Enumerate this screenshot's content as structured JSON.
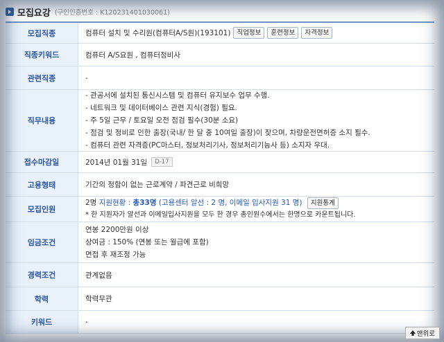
{
  "header": {
    "title": "모집요강",
    "subtitle": "(구인인증번호 : K120231401030061)"
  },
  "rows": {
    "job_category": {
      "label": "모집직종",
      "value": "컴퓨터 설치 및 수리원(컴퓨터A/S원)(193101)",
      "buttons": [
        "직업정보",
        "훈련정보",
        "자격정보"
      ]
    },
    "job_keyword": {
      "label": "직종키워드",
      "value": "컴퓨터 A/S요원 , 컴퓨터정비사"
    },
    "related_job": {
      "label": "관련직종",
      "value": "-"
    },
    "job_description": {
      "label": "직무내용",
      "lines": [
        "- 관공서에 설치된 통신시스템 및 컴퓨터 유지보수 업무 수행.",
        "- 네트워크 및 데이터베이스 관련 지식(경험) 필요.",
        "- 주 5일 근무 / 토요일 오전 점검 필수(30분 소요)",
        "- 점검 및 정비로 인한 출장(국내/ 한 달 중 10여일 출장)이 잦으며, 차량운전면허증 소지 필수.",
        "- 컴퓨터 관련 자격증(PC마스터, 정보처리기사, 정보처리기능사 등) 소지자 우대."
      ]
    },
    "deadline": {
      "label": "접수마감일",
      "value": "2014년 01월 31일",
      "dday": "D-17"
    },
    "employment_type": {
      "label": "고용형태",
      "value": "기간의 정함이 없는 근로계약 / 파견근로 비희망"
    },
    "recruit_count": {
      "label": "모집인원",
      "count": "2명",
      "status_prefix": "지원현황 : ",
      "status_total": "총33명",
      "status_detail": " (고용센터 알선 : 2 명, 이메일 입사지원 31 명)",
      "stats_button": "지원통계",
      "note": "* 한 지원자가 알선과 이메일입사지원을 모두 한 경우 총인원수에서는 한명으로 카운트됩니다."
    },
    "wage": {
      "label": "임금조건",
      "lines": [
        "연봉 2200만원 이상",
        "상여금 : 150% (연봉 또는 월급에 포함)",
        "면접 후 재조정 가능"
      ]
    },
    "experience": {
      "label": "경력조건",
      "value": "관계없음"
    },
    "education": {
      "label": "학력",
      "value": "학력무관"
    },
    "keyword": {
      "label": "키워드",
      "value": "-"
    }
  },
  "scroll_top_label": "맨위로"
}
